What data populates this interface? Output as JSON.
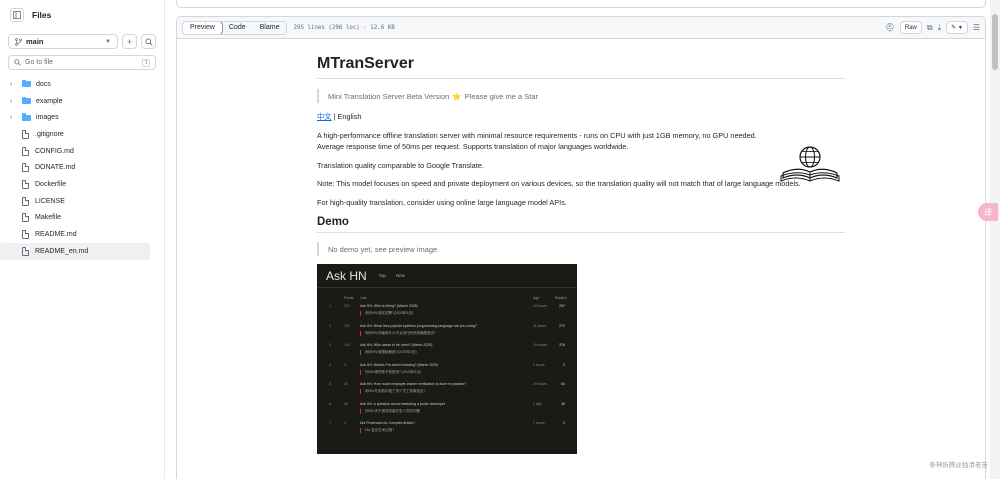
{
  "sidebar": {
    "title": "Files",
    "branch": "main",
    "add_label": "+",
    "search_placeholder": "Go to file",
    "search_shortcut": "t",
    "folders": [
      {
        "label": "docs"
      },
      {
        "label": "example"
      },
      {
        "label": "images"
      }
    ],
    "files": [
      {
        "label": ".gitignore"
      },
      {
        "label": "CONFIG.md"
      },
      {
        "label": "DONATE.md"
      },
      {
        "label": "Dockerfile"
      },
      {
        "label": "LICENSE"
      },
      {
        "label": "Makefile"
      },
      {
        "label": "README.md"
      },
      {
        "label": "README_en.md"
      }
    ]
  },
  "toolbar": {
    "tabs": [
      "Preview",
      "Code",
      "Blame"
    ],
    "meta": "295 lines (206 loc) · 12.6 KB",
    "raw_label": "Raw"
  },
  "readme": {
    "title": "MTranServer",
    "tagline": "Mini Translation Server Beta Version",
    "tagline_star": "⭐",
    "tagline_tail": "Please give me a Star",
    "lang_link": "中文",
    "lang_sep": " | ",
    "lang_current": "English",
    "p1": "A high-performance offline translation server with minimal resource requirements - runs on CPU with just 1GB memory, no GPU needed. Average response time of 50ms per request. Supports translation of major languages worldwide.",
    "p2": "Translation quality comparable to Google Translate.",
    "p3": "Note: This model focuses on speed and private deployment on various devices, so the translation quality will not match that of large language models.",
    "p4": "For high-quality translation, consider using online large language model APIs.",
    "h2": "Demo",
    "demo_quote": "No demo yet, see preview image"
  },
  "preview": {
    "title": "Ask HN",
    "nav": [
      "Top",
      "New"
    ],
    "cols": [
      "Points",
      "Link",
      "Age",
      "Replies"
    ],
    "rows": [
      {
        "n": "1.",
        "pts": "220",
        "t": "Ask HN: Who is hiring? (March 2025)",
        "age": "19 hours",
        "rep": "267",
        "sub": "询问HN:谁在招聘?(2025年3月)"
      },
      {
        "n": "2.",
        "pts": "151",
        "t": "Ask HN: What less-popular systems programming language are you using?",
        "age": "11 hours",
        "rep": "270",
        "sub": "询问HN:你使用什么不太流行的系统编程语言?"
      },
      {
        "n": "3.",
        "pts": "149",
        "t": "Ask HN: Who wants to be hired? (March 2025)",
        "age": "19 hours",
        "rep": "376",
        "sub": "询问HN:谁想被雇用?(2025年3月)"
      },
      {
        "n": "4.",
        "pts": "3",
        "t": "Ask HN: What's Pre-seed Investing? (March 2025)",
        "age": "2 hours",
        "rep": "0",
        "sub": "问HN:哪些种子前投资? (2025年3月)"
      },
      {
        "n": "5.",
        "pts": "36",
        "t": "Ask HN: How much employer-insider verification is done in practice?",
        "age": "19 hours",
        "rep": "64",
        "sub": "询HN:在实践中做了多少员工背景验证?"
      },
      {
        "n": "6.",
        "pts": "26",
        "t": "Ask HN: A question about mentoring a junior developer",
        "age": "1 day",
        "rep": "36",
        "sub": "问HN:关于指导初级开发人员的问题"
      },
      {
        "n": "7.",
        "pts": "2",
        "t": "Dia Processes for Complex Artists?",
        "age": "7 hours",
        "rep": "0",
        "sub": "Dia 复杂艺术过程?"
      }
    ]
  },
  "watermark": "条神折腾@独清老苦",
  "fab_label": "译"
}
